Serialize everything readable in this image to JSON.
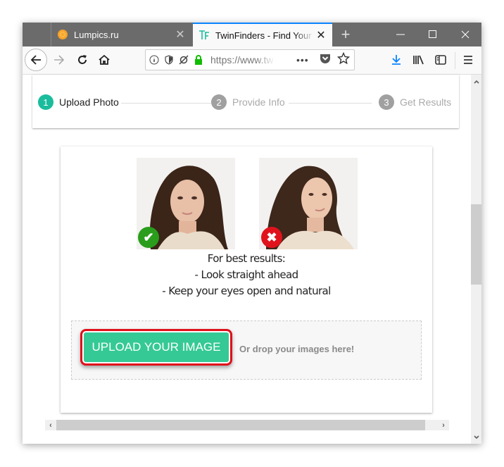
{
  "browser": {
    "tabs": [
      {
        "title": "Lumpics.ru",
        "icon": "orange-icon",
        "active": false
      },
      {
        "title": "TwinFinders - Find Your Tw",
        "icon": "tf-logo-icon",
        "active": true
      }
    ],
    "new_tab": "+",
    "window_controls": {
      "minimize": "—",
      "maximize": "☐",
      "close": "✕"
    },
    "url": "https://www.tw",
    "url_icons": [
      "info-icon",
      "shield-icon",
      "tracking-off-icon",
      "lock-icon"
    ],
    "page_actions": "•••",
    "toolbar_icons": [
      "download-icon",
      "library-icon",
      "sidebar-icon",
      "menu-icon"
    ],
    "accent": "#0a84ff"
  },
  "stepper": {
    "steps": [
      {
        "number": "1",
        "label": "Upload Photo",
        "active": true
      },
      {
        "number": "2",
        "label": "Provide Info",
        "active": false
      },
      {
        "number": "3",
        "label": "Get Results",
        "active": false
      }
    ],
    "active_color": "#1abc9c",
    "inactive_color": "#a0a0a0"
  },
  "examples": {
    "good": {
      "label": "correct-example",
      "badge": "✔"
    },
    "bad": {
      "label": "incorrect-example",
      "badge": "✖"
    }
  },
  "tips": {
    "heading": "For best results:",
    "items": [
      "- Look straight ahead",
      "- Keep your eyes open and natural"
    ]
  },
  "upload": {
    "button_label": "UPLOAD YOUR IMAGE",
    "drop_text": "Or drop your images here!",
    "button_color": "#35c995",
    "highlight_color": "#e0101a"
  },
  "scrollbars": {
    "up": "⌃",
    "down": "⌄",
    "left": "‹",
    "right": "›"
  }
}
